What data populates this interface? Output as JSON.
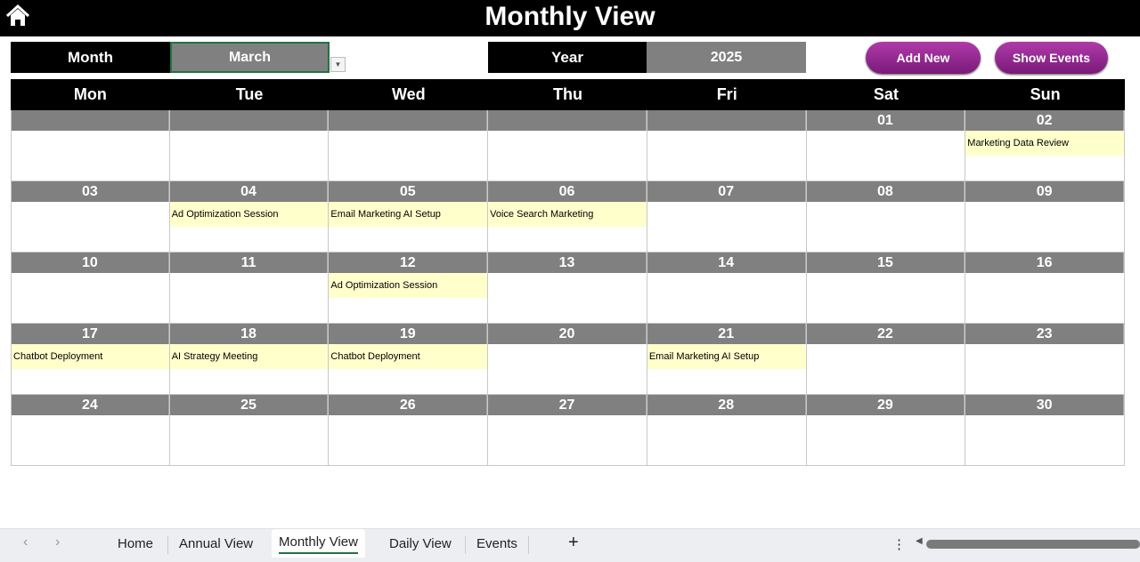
{
  "header": {
    "title": "Monthly View",
    "home_icon": "home-icon"
  },
  "controls": {
    "month_label": "Month",
    "month_value": "March",
    "year_label": "Year",
    "year_value": "2025",
    "add_new": "Add New",
    "show_events": "Show Events",
    "button_color": "#9b2a96"
  },
  "weekdays": [
    "Mon",
    "Tue",
    "Wed",
    "Thu",
    "Fri",
    "Sat",
    "Sun"
  ],
  "weeks": [
    [
      {
        "day": "",
        "event": ""
      },
      {
        "day": "",
        "event": ""
      },
      {
        "day": "",
        "event": ""
      },
      {
        "day": "",
        "event": ""
      },
      {
        "day": "",
        "event": ""
      },
      {
        "day": "01",
        "event": ""
      },
      {
        "day": "02",
        "event": "Marketing Data Review"
      }
    ],
    [
      {
        "day": "03",
        "event": ""
      },
      {
        "day": "04",
        "event": "Ad Optimization Session"
      },
      {
        "day": "05",
        "event": "Email Marketing AI Setup"
      },
      {
        "day": "06",
        "event": "Voice Search Marketing"
      },
      {
        "day": "07",
        "event": ""
      },
      {
        "day": "08",
        "event": ""
      },
      {
        "day": "09",
        "event": ""
      }
    ],
    [
      {
        "day": "10",
        "event": ""
      },
      {
        "day": "11",
        "event": ""
      },
      {
        "day": "12",
        "event": "Ad Optimization Session"
      },
      {
        "day": "13",
        "event": ""
      },
      {
        "day": "14",
        "event": ""
      },
      {
        "day": "15",
        "event": ""
      },
      {
        "day": "16",
        "event": ""
      }
    ],
    [
      {
        "day": "17",
        "event": "Chatbot Deployment"
      },
      {
        "day": "18",
        "event": "AI Strategy Meeting"
      },
      {
        "day": "19",
        "event": "Chatbot Deployment"
      },
      {
        "day": "20",
        "event": ""
      },
      {
        "day": "21",
        "event": "Email Marketing AI Setup"
      },
      {
        "day": "22",
        "event": ""
      },
      {
        "day": "23",
        "event": ""
      }
    ],
    [
      {
        "day": "24",
        "event": ""
      },
      {
        "day": "25",
        "event": ""
      },
      {
        "day": "26",
        "event": ""
      },
      {
        "day": "27",
        "event": ""
      },
      {
        "day": "28",
        "event": ""
      },
      {
        "day": "29",
        "event": ""
      },
      {
        "day": "30",
        "event": ""
      }
    ]
  ],
  "sheet_tabs": {
    "items": [
      "Home",
      "Annual View",
      "Monthly View",
      "Daily View",
      "Events"
    ],
    "active": "Monthly View",
    "add": "+",
    "more": "⋮"
  }
}
